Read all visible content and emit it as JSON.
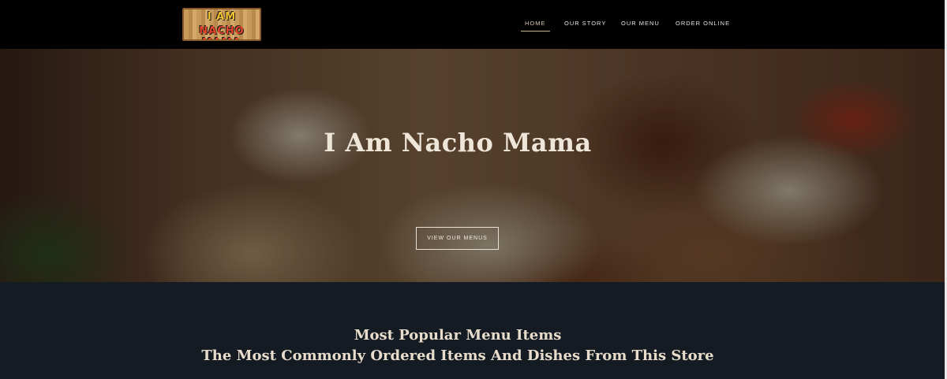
{
  "header": {
    "logo": {
      "line1": "I AM",
      "line2": "NACHO MAMA"
    },
    "nav": [
      {
        "label": "HOME",
        "active": true
      },
      {
        "label": "OUR STORY",
        "active": false
      },
      {
        "label": "OUR MENU",
        "active": false
      },
      {
        "label": "ORDER ONLINE",
        "active": false
      }
    ]
  },
  "hero": {
    "title": "I Am Nacho Mama",
    "button_label": "VIEW OUR MENUS"
  },
  "popular": {
    "title": "Most Popular Menu Items",
    "subtitle": "The Most Commonly Ordered Items And Dishes From This Store"
  },
  "colors": {
    "navbar_bg": "#000000",
    "section_bg": "#151b22",
    "accent_underline": "#c9b58e",
    "text_light": "#efe6da"
  }
}
